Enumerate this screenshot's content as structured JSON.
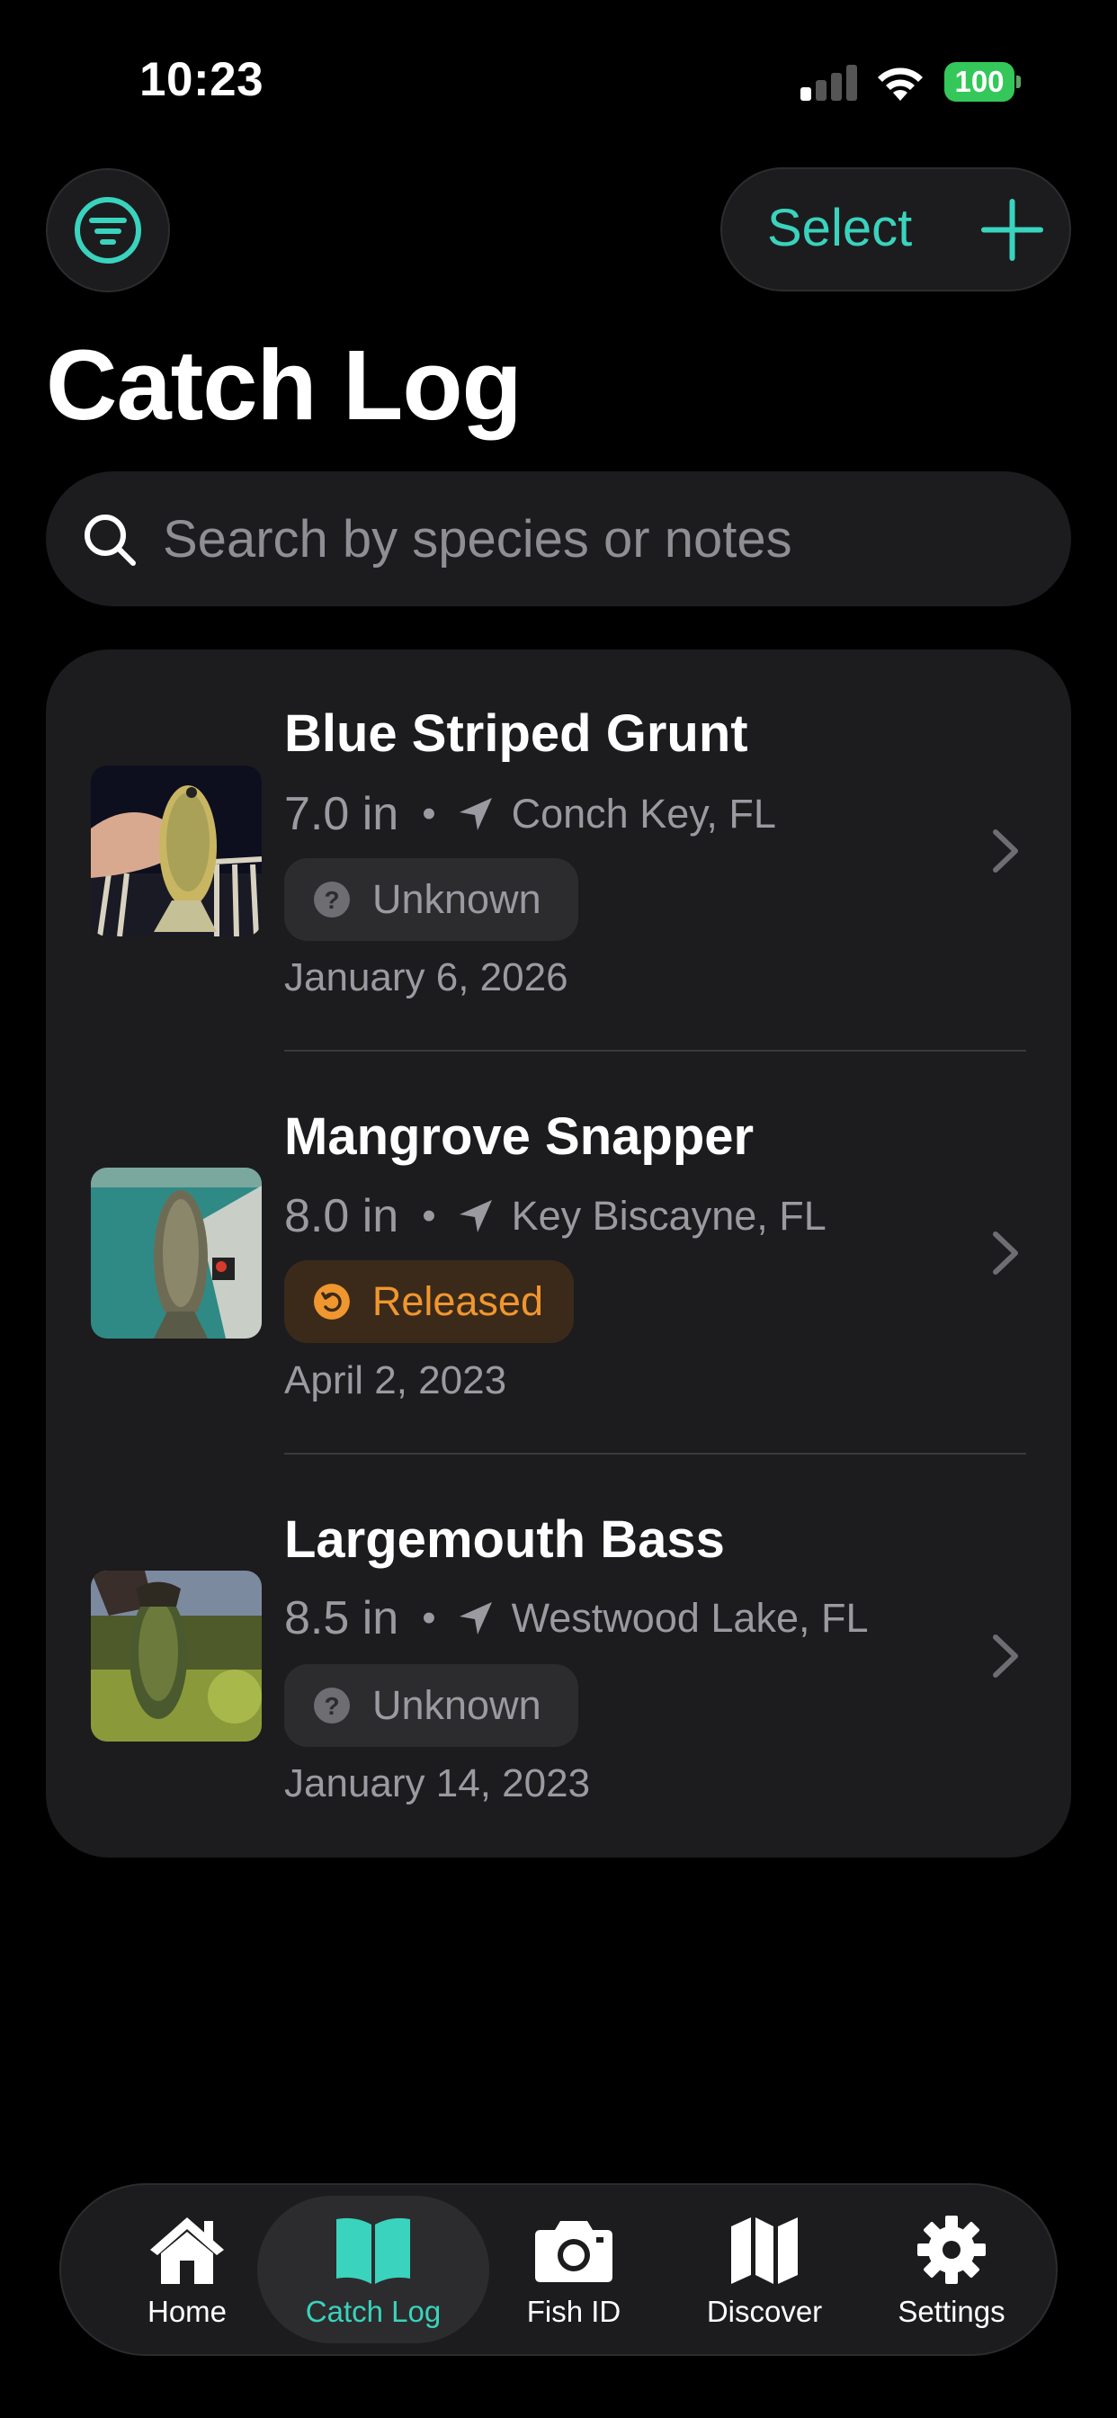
{
  "status_bar": {
    "time": "10:23",
    "battery": "100",
    "icons": [
      "cellular-signal-icon",
      "wifi-icon",
      "battery-icon"
    ],
    "battery_color": "#34c759"
  },
  "header": {
    "filter_icon": "filter-icon",
    "select_label": "Select",
    "add_icon": "plus-icon",
    "title": "Catch Log"
  },
  "search": {
    "placeholder": "Search by species or notes",
    "value": ""
  },
  "catches": [
    {
      "species": "Blue Striped Grunt",
      "length": "7.0 in",
      "location": "Conch Key, FL",
      "status": "Unknown",
      "status_icon": "question-circle-icon",
      "date": "January 6, 2026",
      "photo": "blue-striped-grunt-photo"
    },
    {
      "species": "Mangrove Snapper",
      "length": "8.0 in",
      "location": "Key Biscayne, FL",
      "status": "Released",
      "status_icon": "release-arrow-icon",
      "date": "April 2, 2023",
      "photo": "mangrove-snapper-photo"
    },
    {
      "species": "Largemouth Bass",
      "length": "8.5 in",
      "location": "Westwood Lake, FL",
      "status": "Unknown",
      "status_icon": "question-circle-icon",
      "date": "January 14, 2023",
      "photo": "largemouth-bass-photo"
    }
  ],
  "separator": "•",
  "tabs": [
    {
      "label": "Home",
      "icon": "house-icon",
      "active": false
    },
    {
      "label": "Catch Log",
      "icon": "book-icon",
      "active": true
    },
    {
      "label": "Fish ID",
      "icon": "camera-icon",
      "active": false
    },
    {
      "label": "Discover",
      "icon": "map-icon",
      "active": false
    },
    {
      "label": "Settings",
      "icon": "gear-icon",
      "active": false
    }
  ],
  "colors": {
    "accent": "#3ad3bd",
    "background": "#000000",
    "card": "#1c1c1e",
    "released": "#f0962f",
    "secondary_text": "#9a9aa0"
  }
}
